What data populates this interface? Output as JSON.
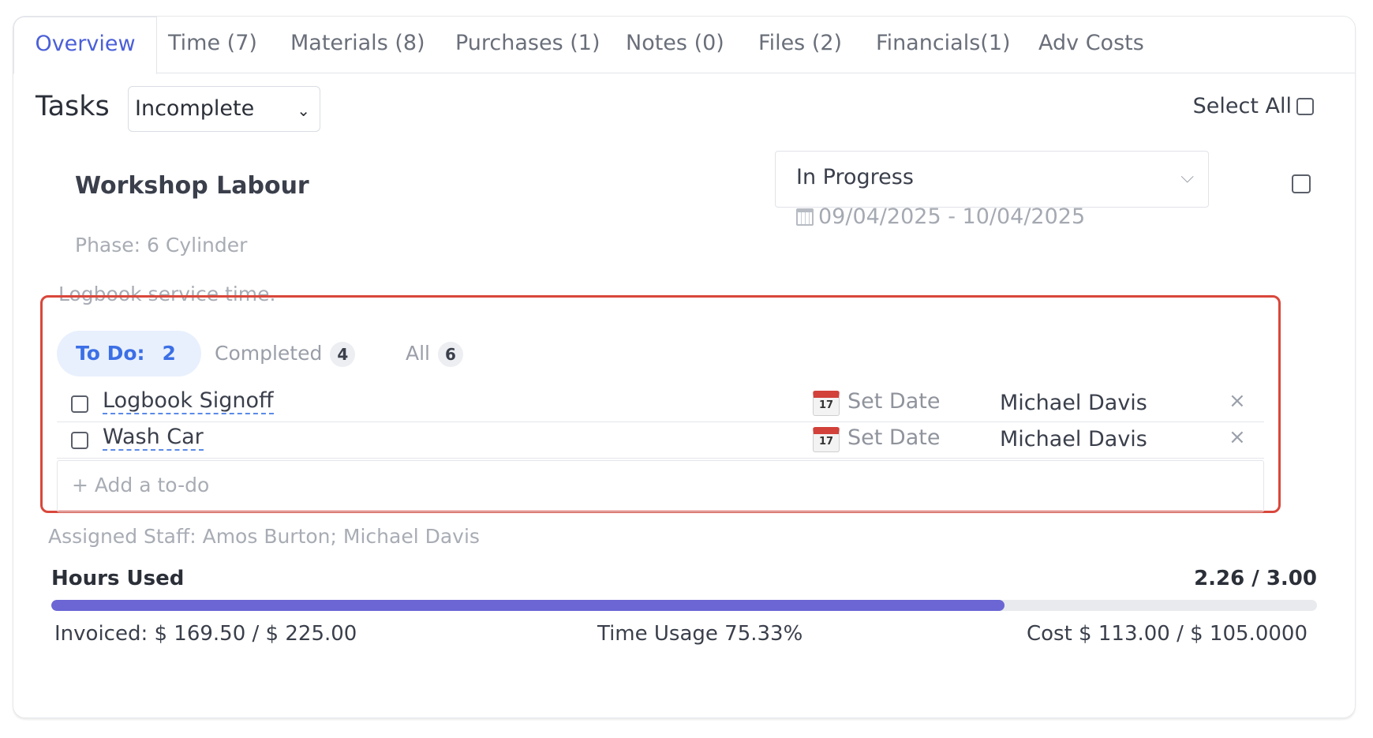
{
  "tabs": [
    {
      "label": "Overview",
      "active": true
    },
    {
      "label": "Time (7)"
    },
    {
      "label": "Materials (8)"
    },
    {
      "label": "Purchases (1)"
    },
    {
      "label": "Notes (0)"
    },
    {
      "label": "Files (2)"
    },
    {
      "label": "Financials(1)"
    },
    {
      "label": "Adv Costs"
    }
  ],
  "tasks": {
    "title": "Tasks",
    "filter_value": "Incomplete",
    "select_all_label": "Select All"
  },
  "task": {
    "name": "Workshop Labour",
    "status": "In Progress",
    "date_range": "09/04/2025 - 10/04/2025",
    "phase": "Phase: 6 Cylinder",
    "description": "Logbook service time."
  },
  "todos": {
    "filters": {
      "todo_label": "To Do:",
      "todo_count": "2",
      "completed_label": "Completed",
      "completed_count": "4",
      "all_label": "All",
      "all_count": "6"
    },
    "items": [
      {
        "label": "Logbook Signoff",
        "date": "Set Date",
        "assignee": "Michael Davis",
        "remove": "×"
      },
      {
        "label": "Wash Car",
        "date": "Set Date",
        "assignee": "Michael Davis",
        "remove": "×"
      }
    ],
    "calendar_day": "17",
    "add_placeholder": "+ Add a to-do"
  },
  "assigned_staff": "Assigned Staff: Amos Burton; Michael Davis",
  "hours": {
    "label": "Hours Used",
    "value": "2.26 / 3.00",
    "progress_fraction": 0.7533
  },
  "footer": {
    "invoiced": "Invoiced: $ 169.50 / $ 225.00",
    "time_usage": "Time Usage 75.33%",
    "cost": "Cost $ 113.00 / $ 105.0000"
  },
  "colors": {
    "accent": "#4a5fd8",
    "progress": "#6b66d4",
    "highlight_border": "#d9473b",
    "todo_pill_bg": "#e8f0fd"
  }
}
